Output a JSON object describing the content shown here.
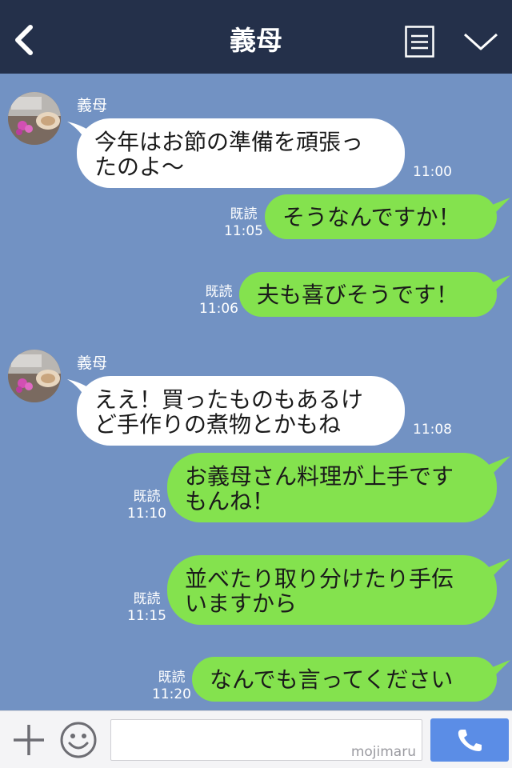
{
  "header": {
    "title": "義母"
  },
  "messages": [
    {
      "side": "left",
      "sender": "義母",
      "text": "今年はお節の準備を頑張っ\nたのよ〜",
      "time": "11:00"
    },
    {
      "side": "right",
      "read": "既読",
      "time": "11:05",
      "text": "そうなんですか！"
    },
    {
      "side": "right",
      "read": "既読",
      "time": "11:06",
      "text": "夫も喜びそうです！"
    },
    {
      "side": "left",
      "sender": "義母",
      "text": "ええ！買ったものもあるけ\nど手作りの煮物とかもね",
      "time": "11:08"
    },
    {
      "side": "right",
      "read": "既読",
      "time": "11:10",
      "text": "お義母さん料理が上手です\nもんね！"
    },
    {
      "side": "right",
      "read": "既読",
      "time": "11:15",
      "text": "並べたり取り分けたり手伝\nいますから"
    },
    {
      "side": "right",
      "read": "既読",
      "time": "11:20",
      "text": "なんでも言ってください"
    }
  ],
  "footer": {
    "watermark": "mojimaru",
    "input_value": ""
  },
  "icons": {
    "back": "back-chevron-icon",
    "menu": "menu-list-icon",
    "collapse": "chevron-down-icon",
    "add": "plus-icon",
    "emoji": "smiley-icon",
    "call": "phone-icon"
  },
  "colors": {
    "header_bg": "#24304a",
    "chat_bg": "#7292c3",
    "my_bubble": "#84e24e",
    "their_bubble": "#ffffff",
    "call_button": "#5b8de6"
  }
}
